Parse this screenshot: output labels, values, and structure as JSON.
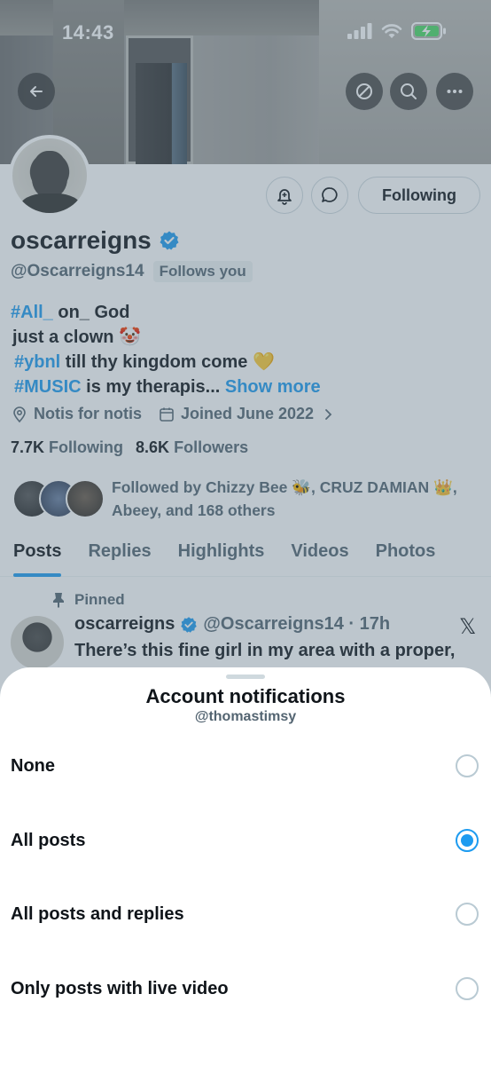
{
  "status_bar": {
    "time": "14:43"
  },
  "profile": {
    "display_name": "oscarreigns",
    "handle": "@Oscarreigns14",
    "follows_you": "Follows you",
    "following_button": "Following",
    "bio": {
      "line1_tag": "#All_",
      "line1_text": " on_ God",
      "line2_text": "just a clown 🤡",
      "line3_tag": "#ybnl",
      "line3_text": " till thy kingdom come 💛",
      "line4_tag": "#MUSIC",
      "line4_text": " is my therapis...",
      "show_more": "Show more"
    },
    "location": "Notis for notis",
    "joined": "Joined June 2022",
    "following_count": "7.7K",
    "following_label": "Following",
    "followers_count": "8.6K",
    "followers_label": "Followers",
    "followed_by": "Followed by Chizzy Bee 🐝, CRUZ DAMIAN 👑, Abeey, and 168 others"
  },
  "tabs": [
    "Posts",
    "Replies",
    "Highlights",
    "Videos",
    "Photos"
  ],
  "pinned_post": {
    "pinned_label": "Pinned",
    "name": "oscarreigns",
    "handle_time": "@Oscarreigns14 · 17h",
    "text": "There’s this fine girl in my area with a proper,"
  },
  "sheet": {
    "title": "Account notifications",
    "subtitle": "@thomastimsy",
    "options": [
      {
        "label": "None",
        "selected": false
      },
      {
        "label": "All posts",
        "selected": true
      },
      {
        "label": "All posts and replies",
        "selected": false
      },
      {
        "label": "Only posts with live video",
        "selected": false
      }
    ]
  },
  "colors": {
    "accent": "#1d9bf0",
    "text": "#0f1419",
    "muted": "#536471"
  }
}
